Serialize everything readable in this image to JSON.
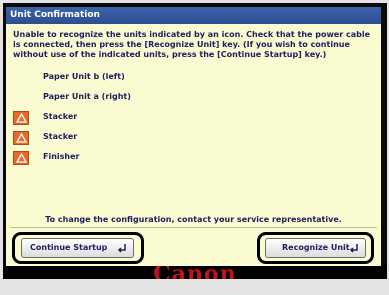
{
  "dialog": {
    "title": "Unit Confirmation",
    "message": "Unable to recognize the units indicated by an icon. Check that the power cable is connected, then press the [Recognize Unit] key. (If you wish to continue without use of the indicated units, press the [Continue Startup] key.)",
    "units": [
      {
        "label": "Paper Unit b (left)",
        "warning": false
      },
      {
        "label": "Paper Unit a (right)",
        "warning": false
      },
      {
        "label": "Stacker",
        "warning": true,
        "icon": "warning-triangle-icon"
      },
      {
        "label": "Stacker",
        "warning": true,
        "icon": "warning-triangle-icon"
      },
      {
        "label": "Finisher",
        "warning": true,
        "icon": "warning-triangle-icon"
      }
    ],
    "footer_note": "To change the configuration, contact your service representative.",
    "buttons": {
      "continue_label": "Continue Startup",
      "recognize_label": "Recognize Unit"
    }
  },
  "device": {
    "logo_text": "Canon"
  },
  "colors": {
    "title_bar": "#2f569b",
    "screen_bg": "#fbfbd1",
    "text": "#1d1d60",
    "warning": "#e66a2a",
    "logo": "#c4121a"
  }
}
